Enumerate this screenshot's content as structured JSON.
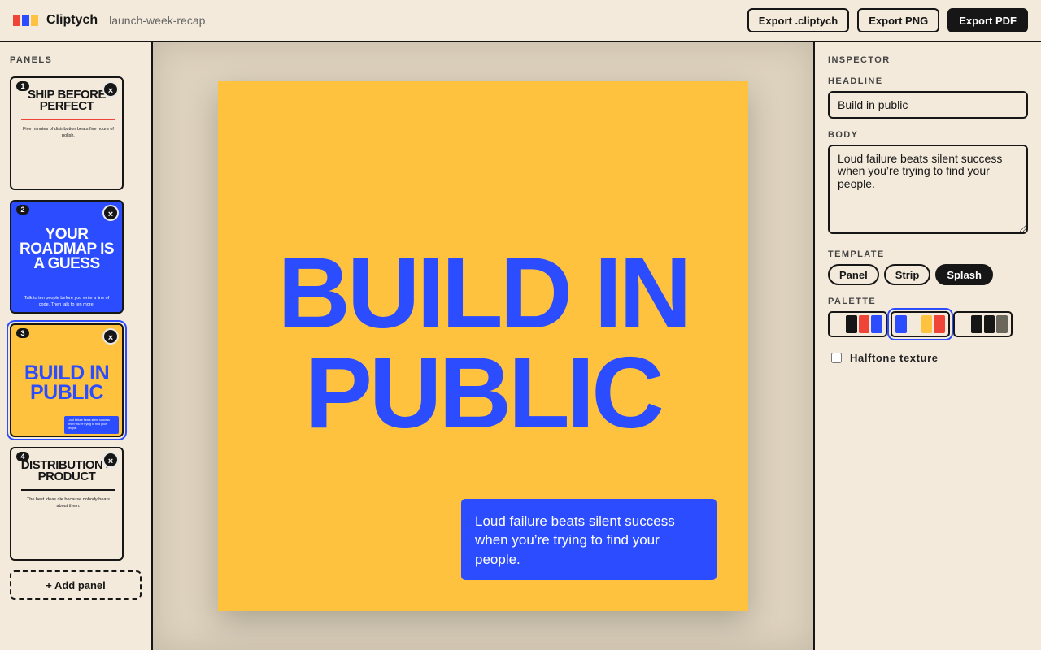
{
  "app": {
    "name": "Cliptych",
    "document": "launch-week-recap",
    "logo_colors": [
      "#f04438",
      "#2b4dff",
      "#ffc23e"
    ]
  },
  "toolbar": {
    "export_cliptych": "Export .cliptych",
    "export_png": "Export PNG",
    "export_pdf": "Export PDF"
  },
  "sidebar": {
    "title": "PANELS",
    "add_panel": "+ Add panel",
    "close_glyph": "×",
    "panels": [
      {
        "number": "1",
        "headline": "SHIP BEFORE PERFECT",
        "body": "Five minutes of distribution beats five hours of polish."
      },
      {
        "number": "2",
        "headline": "YOUR ROADMAP IS A GUESS",
        "body": "Talk to ten people before you write a line of code. Then talk to ten more."
      },
      {
        "number": "3",
        "headline": "BUILD IN PUBLIC",
        "body": "Loud failure beats silent success when you’re trying to find your people.",
        "selected": true
      },
      {
        "number": "4",
        "headline": "DISTRIBUTION > PRODUCT",
        "body": "The best ideas die because nobody hears about them."
      }
    ]
  },
  "canvas": {
    "headline": "BUILD IN\nPUBLIC",
    "body": "Loud failure beats silent success when you’re trying to find your people.",
    "background": "#ffc23e",
    "accent": "#2b4dff"
  },
  "inspector": {
    "title": "INSPECTOR",
    "headline_label": "HEADLINE",
    "headline_value": "Build in public",
    "body_label": "BODY",
    "body_value": "Loud failure beats silent success when you’re trying to find your people.",
    "template_label": "TEMPLATE",
    "templates": [
      "Panel",
      "Strip",
      "Splash"
    ],
    "active_template": "Splash",
    "palette_label": "PALETTE",
    "palettes": [
      [
        "#f3eadb",
        "#161616",
        "#f04438",
        "#2b4dff"
      ],
      [
        "#2b4dff",
        "#f3eadb",
        "#ffc23e",
        "#f04438"
      ],
      [
        "#f3eadb",
        "#161616",
        "#161616",
        "#6b665c"
      ]
    ],
    "selected_palette": 1,
    "halftone_label": "Halftone texture",
    "halftone_checked": false
  }
}
